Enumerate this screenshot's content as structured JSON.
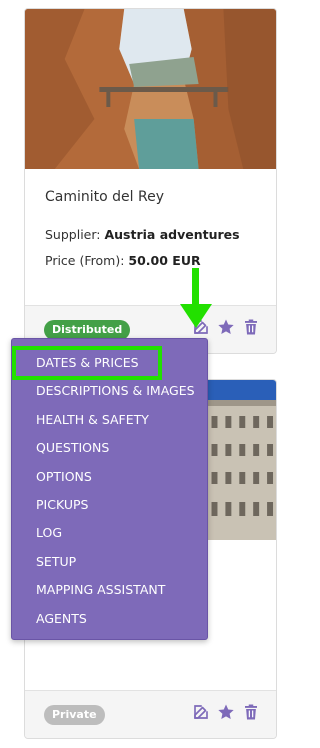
{
  "cards": [
    {
      "title": "Caminito del Rey",
      "supplier_label": "Supplier:",
      "supplier_value": "Austria adventures",
      "price_label": "Price (From):",
      "price_value": "50.00 EUR",
      "status": "Distributed",
      "status_color": "#43a047"
    },
    {
      "status": "Private",
      "status_color": "#bdbdbd"
    }
  ],
  "actions": {
    "edit_icon": "edit-icon",
    "star_icon": "star-icon",
    "delete_icon": "trash-icon"
  },
  "dropdown": {
    "items": [
      "DATES & PRICES",
      "DESCRIPTIONS & IMAGES",
      "HEALTH & SAFETY",
      "QUESTIONS",
      "OPTIONS",
      "PICKUPS",
      "LOG",
      "SETUP",
      "MAPPING ASSISTANT",
      "AGENTS"
    ],
    "highlighted_index": 0
  },
  "colors": {
    "accent": "#7e6ab9",
    "highlight": "#22e000"
  }
}
